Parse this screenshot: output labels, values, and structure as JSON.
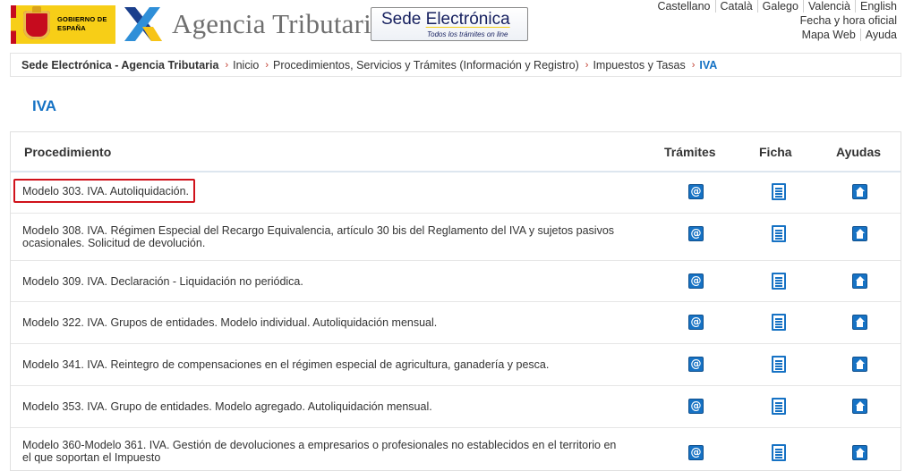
{
  "header": {
    "gov_logo_text": "GOBIERNO DE ESPAÑA",
    "agency_title": "Agencia Tributaria",
    "sede_main_a": "Sede ",
    "sede_main_b": "Electrónica",
    "sede_sub": "Todos los trámites on line",
    "languages": [
      "Castellano",
      "Català",
      "Galego",
      "Valencià",
      "English"
    ],
    "fecha_link": "Fecha y hora oficial",
    "util_links": [
      "Mapa Web",
      "Ayuda"
    ]
  },
  "breadcrumb": {
    "root": "Sede Electrónica - Agencia Tributaria",
    "items": [
      "Inicio",
      "Procedimientos, Servicios y Trámites (Información y Registro)",
      "Impuestos y Tasas"
    ],
    "current": "IVA",
    "separator": "›"
  },
  "page_title": "IVA",
  "table": {
    "headers": {
      "procedimiento": "Procedimiento",
      "tramites": "Trámites",
      "ficha": "Ficha",
      "ayudas": "Ayudas"
    },
    "icons": {
      "tramites": "at-sign-icon",
      "ficha": "document-icon",
      "ayudas": "home-icon"
    },
    "tramites_glyph": "@",
    "rows": [
      {
        "line1": "Modelo 303. IVA. Autoliquidación.",
        "line2": "",
        "highlighted": true
      },
      {
        "line1": "Modelo 308. IVA. Régimen Especial del Recargo Equivalencia, artículo 30 bis del Reglamento del IVA y sujetos pasivos",
        "line2": "ocasionales. Solicitud de devolución.",
        "highlighted": false
      },
      {
        "line1": "Modelo 309. IVA. Declaración - Liquidación no periódica.",
        "line2": "",
        "highlighted": false
      },
      {
        "line1": "Modelo 322. IVA. Grupos de entidades. Modelo individual. Autoliquidación mensual.",
        "line2": "",
        "highlighted": false
      },
      {
        "line1": "Modelo 341. IVA. Reintegro de compensaciones en el régimen especial de agricultura, ganadería y pesca.",
        "line2": "",
        "highlighted": false
      },
      {
        "line1": "Modelo 353. IVA. Grupo de entidades. Modelo agregado. Autoliquidación mensual.",
        "line2": "",
        "highlighted": false
      },
      {
        "line1": "Modelo 360-Modelo 361. IVA. Gestión de devoluciones a empresarios o profesionales no establecidos en el territorio en",
        "line2": "el que soportan el Impuesto",
        "highlighted": false
      }
    ]
  },
  "colors": {
    "accent": "#1572c4",
    "highlight": "#d0121b",
    "breadcrumb_sep": "#c0392b"
  }
}
